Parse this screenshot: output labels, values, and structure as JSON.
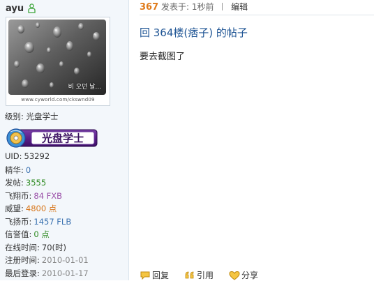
{
  "sidebar": {
    "username": "ayu",
    "avatar": {
      "overlay_text": "비 오던 날...",
      "caption": "www.cyworld.com/ckswnd09"
    },
    "level": {
      "label": "级别:",
      "value": "光盘学士"
    },
    "badge_text": "光盘学士",
    "stats": [
      {
        "label": "UID:",
        "value": "53292",
        "color": "plain"
      },
      {
        "label": "精华:",
        "value": "0",
        "color": "blue"
      },
      {
        "label": "发帖:",
        "value": "3555",
        "color": "green"
      },
      {
        "label": "飞翔币:",
        "value": "84 FXB",
        "color": "purple"
      },
      {
        "label": "威望:",
        "value": "4800 点",
        "color": "orange"
      },
      {
        "label": "飞扬币:",
        "value": "1457 FLB",
        "color": "blue"
      },
      {
        "label": "信誉值:",
        "value": "0 点",
        "color": "green"
      },
      {
        "label": "在线时间:",
        "value": "70(时)",
        "color": "plain"
      },
      {
        "label": "注册时间:",
        "value": "2010-01-01",
        "color": "gray"
      },
      {
        "label": "最后登录:",
        "value": "2010-01-17",
        "color": "gray"
      }
    ]
  },
  "post": {
    "floor": "367",
    "posted_label": "发表于: 1秒前",
    "edit_label": "编辑",
    "title": "回  364楼(痞子) 的帖子",
    "body": "要去截图了"
  },
  "actions": {
    "reply": "回复",
    "quote": "引用",
    "share": "分享"
  },
  "colors": {
    "sidebar_bg": "#f3f7fb",
    "title_blue": "#1e5494",
    "floor_orange": "#e07b1b"
  }
}
